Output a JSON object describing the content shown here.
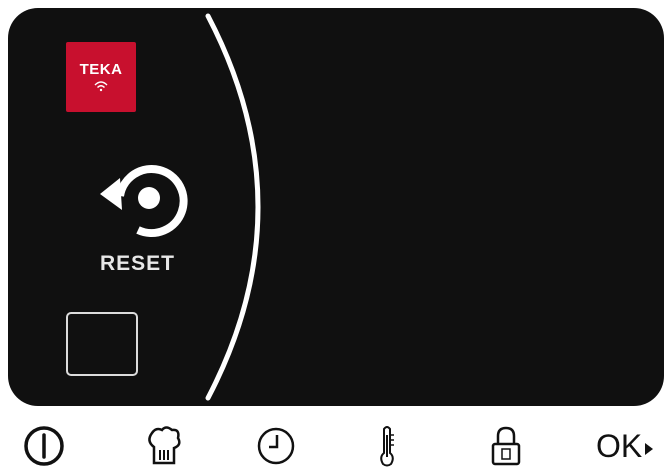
{
  "display": {
    "brand": "TEKA",
    "reset_label": "RESET"
  },
  "icons": {
    "brand_icon": "wifi-icon",
    "reset_icon": "reset-icon",
    "square_icon": "empty-square"
  },
  "controls": {
    "power": "power-icon",
    "chef": "chef-hat-icon",
    "clock": "clock-icon",
    "temperature": "thermometer-icon",
    "lock": "lock-icon",
    "ok_label": "OK"
  },
  "colors": {
    "screen": "#101010",
    "brand": "#c8102e",
    "foreground": "#ffffff",
    "button_ink": "#111111"
  }
}
